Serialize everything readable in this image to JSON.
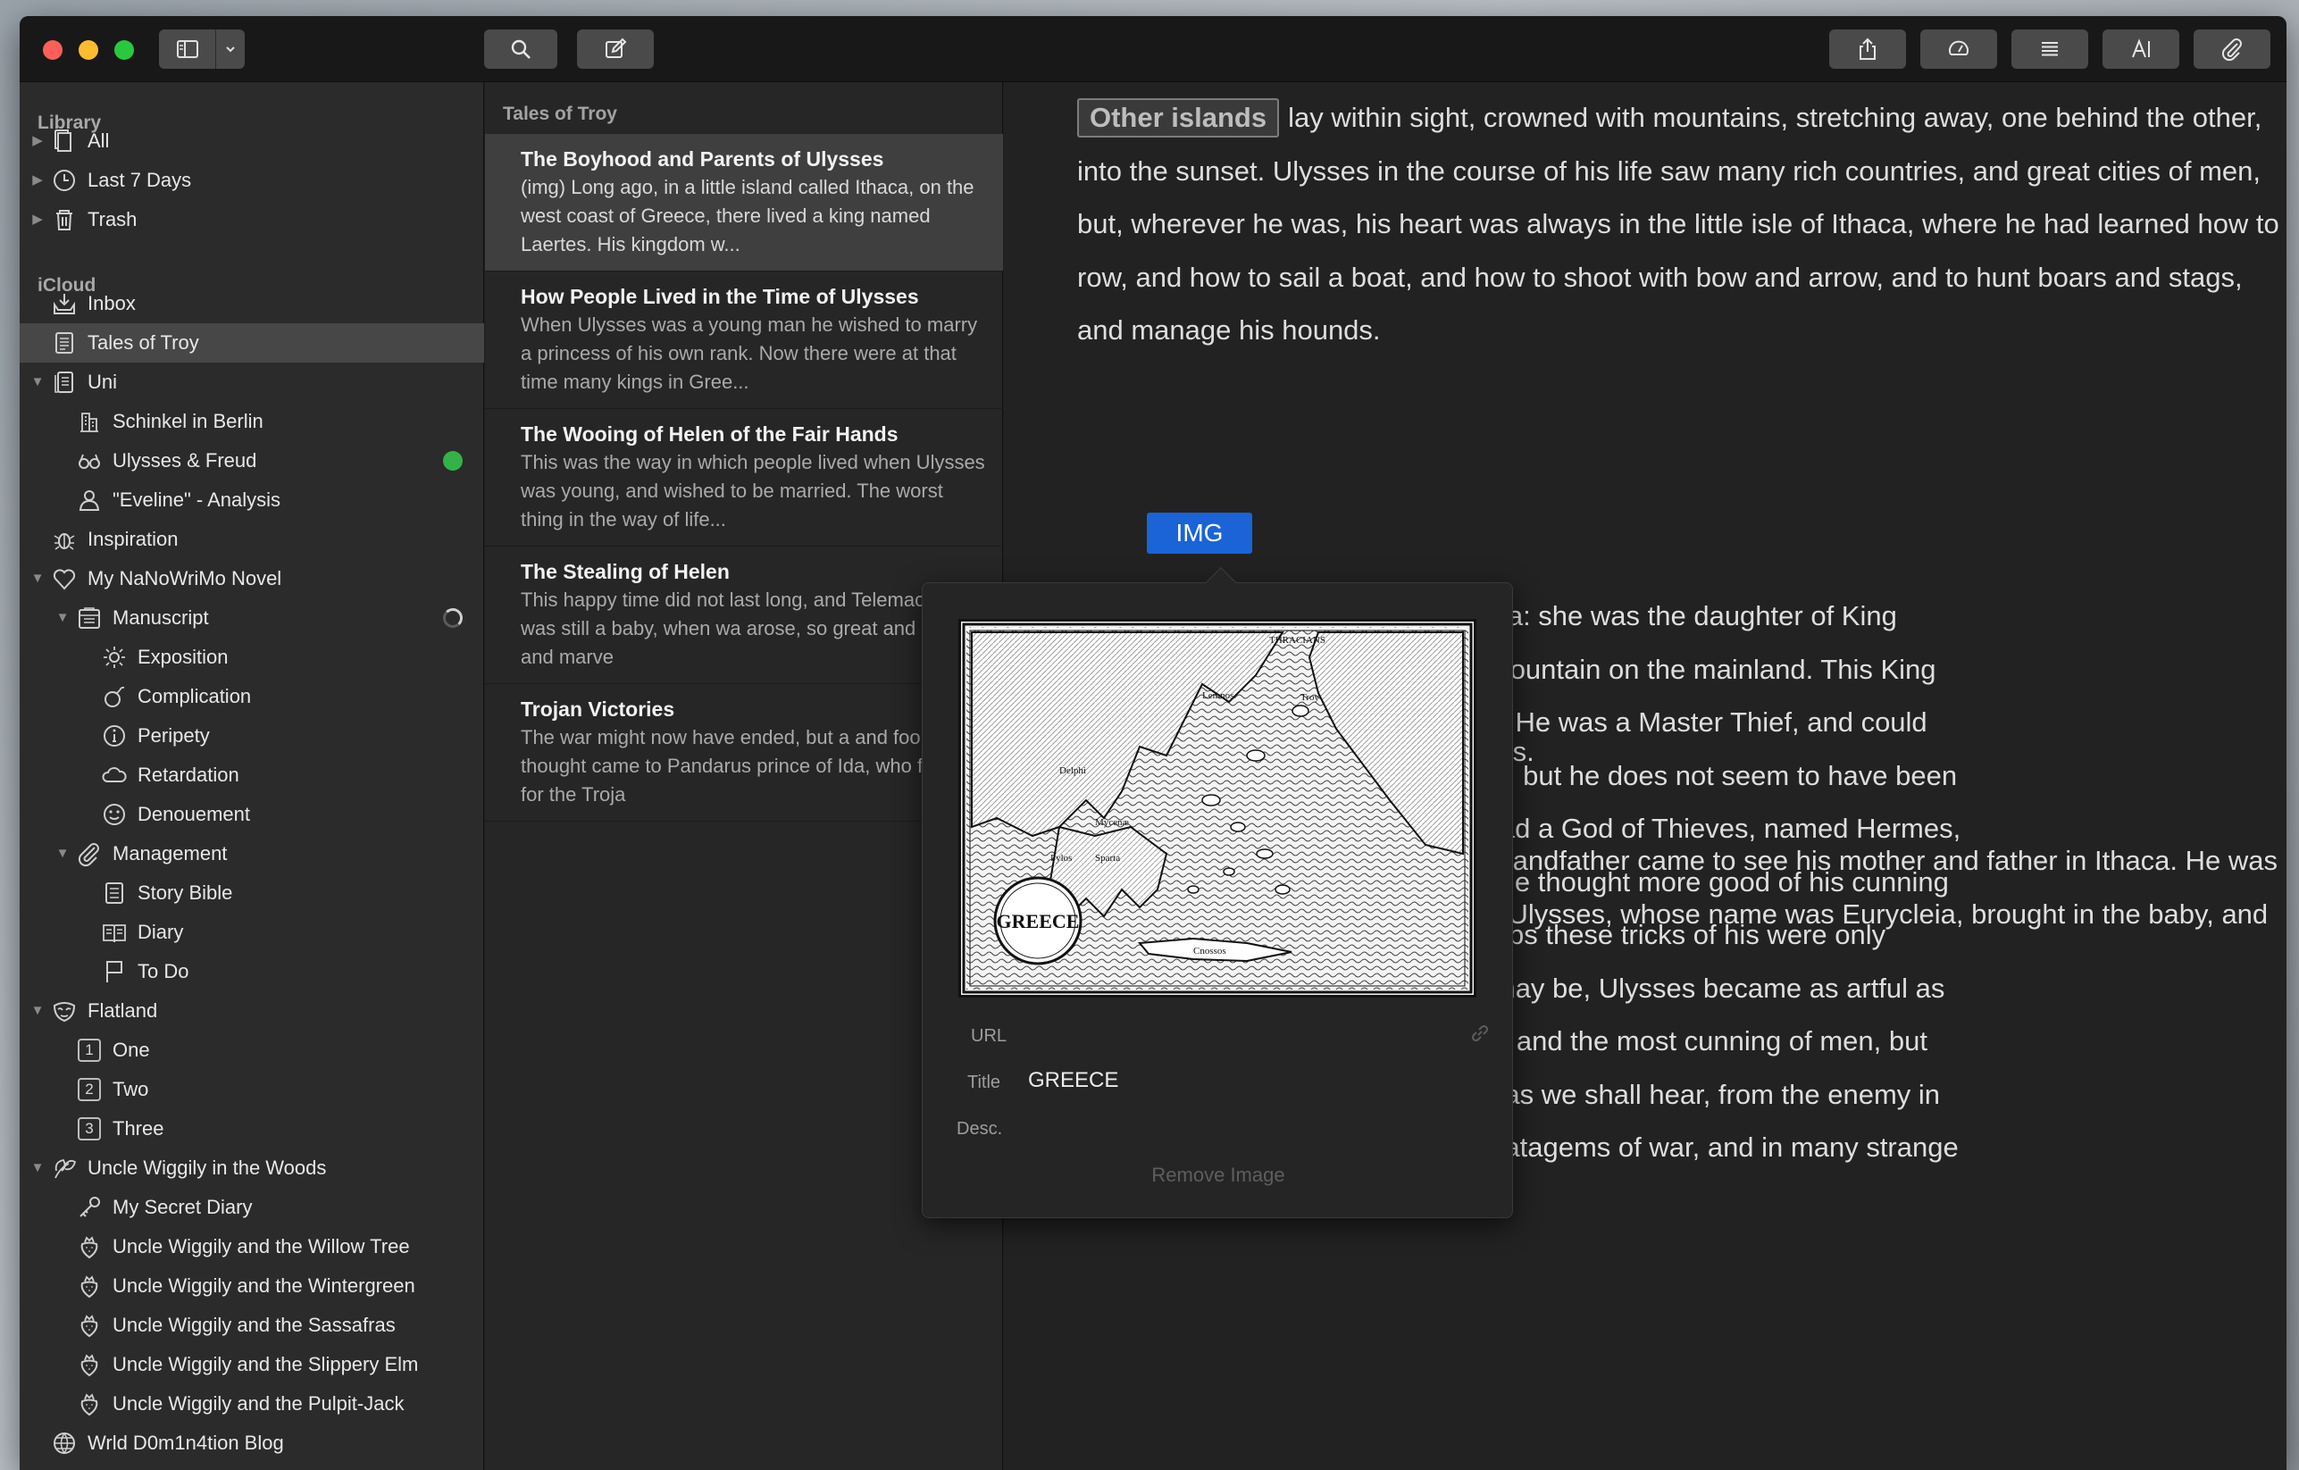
{
  "toolbar": {
    "icons": [
      "sidebar-toggle-icon",
      "chevron-down-icon",
      "search-icon",
      "compose-icon",
      "share-icon",
      "goals-icon",
      "list-icon",
      "typography-icon",
      "attachment-icon"
    ]
  },
  "sidebar": {
    "library_label": "Library",
    "icloud_label": "iCloud",
    "library": [
      {
        "label": "All",
        "icon": "sheets-icon"
      },
      {
        "label": "Last 7 Days",
        "icon": "clock-icon"
      },
      {
        "label": "Trash",
        "icon": "trash-icon"
      }
    ],
    "icloud": [
      {
        "label": "Inbox",
        "icon": "inbox-icon"
      },
      {
        "label": "Tales of Troy",
        "icon": "document-icon"
      },
      {
        "label": "Uni",
        "icon": "documents-icon"
      },
      {
        "label": "Schinkel in Berlin",
        "icon": "building-icon"
      },
      {
        "label": "Ulysses & Freud",
        "icon": "glasses-icon"
      },
      {
        "label": "\"Eveline\" - Analysis",
        "icon": "person-icon"
      },
      {
        "label": "Inspiration",
        "icon": "bug-icon"
      },
      {
        "label": "My NaNoWriMo Novel",
        "icon": "heart-icon"
      },
      {
        "label": "Manuscript",
        "icon": "book-icon"
      },
      {
        "label": "Exposition",
        "icon": "sun-icon"
      },
      {
        "label": "Complication",
        "icon": "bomb-icon"
      },
      {
        "label": "Peripety",
        "icon": "info-circle-icon"
      },
      {
        "label": "Retardation",
        "icon": "cloud-icon"
      },
      {
        "label": "Denouement",
        "icon": "smiley-icon"
      },
      {
        "label": "Management",
        "icon": "paperclip-icon"
      },
      {
        "label": "Story Bible",
        "icon": "notes-icon"
      },
      {
        "label": "Diary",
        "icon": "open-book-icon"
      },
      {
        "label": "To Do",
        "icon": "flag-icon"
      },
      {
        "label": "Flatland",
        "icon": "mask-icon"
      },
      {
        "label": "One",
        "number": "1"
      },
      {
        "label": "Two",
        "number": "2"
      },
      {
        "label": "Three",
        "number": "3"
      },
      {
        "label": "Uncle Wiggily in the Woods",
        "icon": "leaf-icon"
      },
      {
        "label": "My Secret Diary",
        "icon": "key-icon"
      },
      {
        "label": "Uncle Wiggily and the Willow Tree",
        "icon": "strawberry-icon"
      },
      {
        "label": "Uncle Wiggily and the Wintergreen",
        "icon": "strawberry-icon"
      },
      {
        "label": "Uncle Wiggily and the Sassafras",
        "icon": "strawberry-icon"
      },
      {
        "label": "Uncle Wiggily and the Slippery Elm",
        "icon": "strawberry-icon"
      },
      {
        "label": "Uncle Wiggily and the Pulpit-Jack",
        "icon": "strawberry-icon"
      },
      {
        "label": "Wrld D0m1n4tion Blog",
        "icon": "globe-icon"
      }
    ],
    "status_colors": {
      "green_dot": "#33b249"
    }
  },
  "notelist": {
    "title": "Tales of Troy",
    "items": [
      {
        "title": "The Boyhood and Parents of Ulysses",
        "snippet": "(img) Long ago, in a little island called Ithaca, on the west coast of Greece, there lived a king named Laertes. His kingdom w..."
      },
      {
        "title": "How People Lived in the Time of Ulysses",
        "snippet": "When Ulysses was a young man he wished to marry a princess of his own rank. Now there were at that time many kings in Gree..."
      },
      {
        "title": "The Wooing of Helen of the Fair Hands",
        "snippet": "This was the way in which people lived when Ulysses was young, and wished to be married. The worst thing in the way of life..."
      },
      {
        "title": "The Stealing of Helen",
        "snippet": "This happy time did not last long, and Telemachus was still a baby, when wa arose, so great and mighty and marve"
      },
      {
        "title": "Trojan Victories",
        "snippet": "The war might now have ended, but a and foolish thought came to Pandarus prince of Ida, who fought for the Troja"
      }
    ]
  },
  "editor": {
    "tag": "Other islands",
    "para1_after_tag": "lay within sight, crowned with mountains, stretching away, one behind the other, into the sunset. Ulysses in the course of his life saw many rich countries, and great cities of men, but, wherever he was, his heart was always in the little isle of Ithaca, where he had learned how to row, and how to sail a boat, and how to shoot with bow and arrow, and to hunt boars and stags, and manage his hounds.",
    "img_chip": "IMG",
    "para2_lines": [
      "called Anticleia: she was the daughter of King",
      "arnassus, a mountain on the mainland. This King",
      "nning of men. He was a Master Thief, and could",
      "nder his head, but he does not seem to have been",
      "he Greeks had a God of Thieves, named Hermes,",
      "ed, and people thought more good of his cunning",
      "onesty. Perhaps these tricks of his were only",
      "owever that may be, Ulysses became as artful as",
      "h the bravest and the most cunning of men, but",
      "except once, as we shall hear, from the enemy in",
      "cunning in stratagems of war, and in many strange"
    ],
    "para2_last": "escapes from giants and man-eaters.",
    "para3": "Soon after Ulysses was born, his grandfather came to see his mother and father in Ithaca. He was sitting at supper when the nurse of Ulysses, whose name was Eurycleia, brought in the baby, and set him on the knees of"
  },
  "popover": {
    "url_label": "URL",
    "url_value": "",
    "title_label": "Title",
    "title_value": "GREECE",
    "desc_label": "Desc.",
    "desc_value": "",
    "remove_label": "Remove Image",
    "map_seal_text": "GREECE",
    "map_labels": [
      "THRACIANS",
      "Troy",
      "Lemnos",
      "Delphi",
      "Mycenæ",
      "Sparta",
      "Pylos",
      "Cnossos"
    ]
  }
}
